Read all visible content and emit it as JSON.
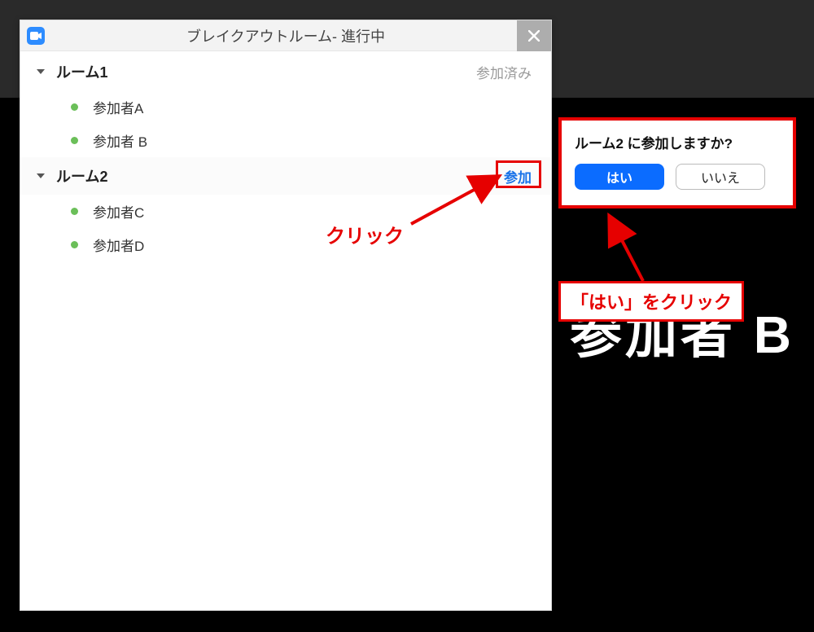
{
  "window": {
    "title": "ブレイクアウトルーム- 進行中"
  },
  "rooms": [
    {
      "name": "ルーム1",
      "status": "参加済み",
      "participants": [
        "参加者A",
        "参加者 B"
      ]
    },
    {
      "name": "ルーム2",
      "join_label": "参加",
      "participants": [
        "参加者C",
        "参加者D"
      ]
    }
  ],
  "confirm": {
    "title": "ルーム2 に参加しますか?",
    "yes": "はい",
    "no": "いいえ"
  },
  "annotation": {
    "click": "クリック",
    "click_yes": "「はい」をクリック"
  },
  "background": {
    "participant_text": "参加者 B"
  }
}
